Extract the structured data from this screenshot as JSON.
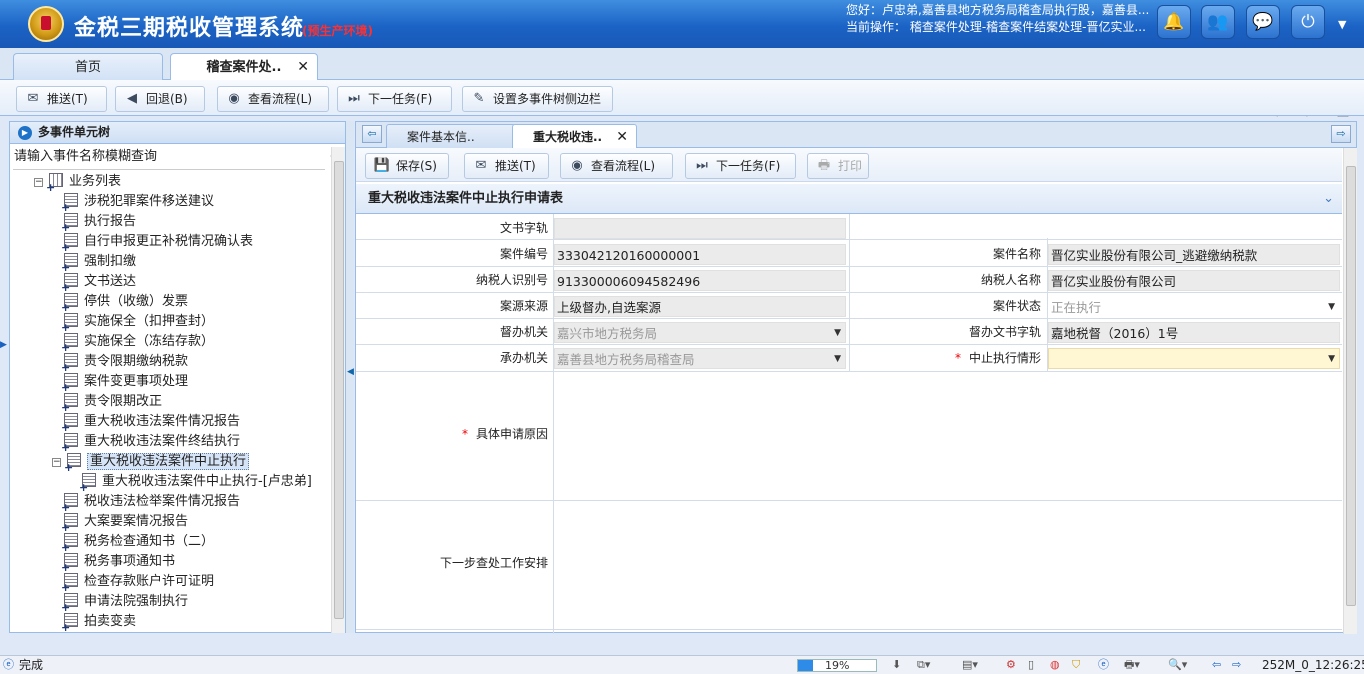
{
  "header": {
    "title": "金税三期税收管理系统",
    "env": "(预生产环境)",
    "user_line": "您好：卢忠弟,嘉善县地方税务局稽查局执行股，嘉善县...",
    "op_line": "当前操作： 稽查案件处理-稽查案件结案处理-晋亿实业...",
    "icons": [
      "bell-icon",
      "users-icon",
      "chat-icon",
      "power-icon"
    ]
  },
  "top_tabs": [
    {
      "label": "首页"
    },
    {
      "label": "稽查案件处..",
      "close": "✕"
    }
  ],
  "toolbar1": {
    "push": "推送(T)",
    "rollback": "回退(B)",
    "view_flow": "查看流程(L)",
    "next_task": "下一任务(F)",
    "set_sidebar": "设置多事件树侧边栏"
  },
  "left_panel": {
    "title": "多事件单元树",
    "search_placeholder": "请输入事件名称模糊查询",
    "root": "业务列表",
    "items": [
      "涉税犯罪案件移送建议",
      "执行报告",
      "自行申报更正补税情况确认表",
      "强制扣缴",
      "文书送达",
      "停供（收缴）发票",
      "实施保全（扣押查封）",
      "实施保全（冻结存款）",
      "责令限期缴纳税款",
      "案件变更事项处理",
      "责令限期改正",
      "重大税收违法案件情况报告",
      "重大税收违法案件终结执行",
      "重大税收违法案件中止执行",
      "重大税收违法案件中止执行-[卢忠弟]",
      "税收违法检举案件情况报告",
      "大案要案情况报告",
      "税务检查通知书（二）",
      "税务事项通知书",
      "检查存款账户许可证明",
      "申请法院强制执行",
      "拍卖变卖"
    ]
  },
  "inner_tabs": [
    {
      "label": "案件基本信.."
    },
    {
      "label": "重大税收违..",
      "close": "✕"
    }
  ],
  "toolbar2": {
    "save": "保存(S)",
    "push": "推送(T)",
    "view_flow": "查看流程(L)",
    "next_task": "下一任务(F)",
    "print": "打印"
  },
  "form": {
    "title": "重大税收违法案件中止执行申请表",
    "labels": {
      "doc_word": "文书字轨",
      "case_no": "案件编号",
      "case_name": "案件名称",
      "taxpayer_id": "纳税人识别号",
      "taxpayer_name": "纳税人名称",
      "case_source": "案源来源",
      "case_status": "案件状态",
      "supervise_org": "督办机关",
      "supervise_doc": "督办文书字轨",
      "handle_org": "承办机关",
      "suspend_situation": "中止执行情形",
      "reason": "具体申请原因",
      "next_plan": "下一步查处工作安排"
    },
    "values": {
      "doc_word": "",
      "case_no": "333042120160000001",
      "case_name": "晋亿实业股份有限公司_逃避缴纳税款",
      "taxpayer_id": "913300006094582496",
      "taxpayer_name": "晋亿实业股份有限公司",
      "case_source": "上级督办,自选案源",
      "case_status": "正在执行",
      "supervise_org": "嘉兴市地方税务局",
      "supervise_doc": "嘉地税督（2016）1号",
      "handle_org": "嘉善县地方税务局稽查局",
      "suspend_situation": "",
      "reason": "",
      "next_plan": ""
    }
  },
  "status_bar": {
    "text": "完成",
    "progress": 19,
    "progress_label": "19%",
    "right_text": "252M_0_12:26:25"
  }
}
